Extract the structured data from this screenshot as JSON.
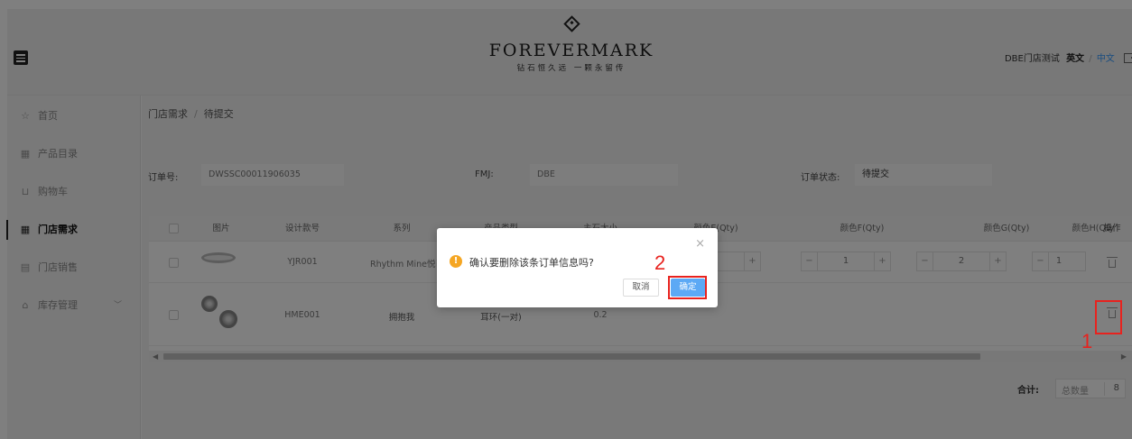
{
  "header": {
    "brand": "FOREVERMARK",
    "tagline": "钻石恒久远 一颗永留传",
    "store": "DBE门店测试",
    "lang_en": "英文",
    "lang_sep": "/",
    "lang_zh": "中文",
    "colors": {
      "accent": "#3399ff"
    }
  },
  "sidebar": {
    "items": [
      {
        "label": "首页",
        "icon": "home-icon"
      },
      {
        "label": "产品目录",
        "icon": "grid-icon"
      },
      {
        "label": "购物车",
        "icon": "cart-icon"
      },
      {
        "label": "门店需求",
        "icon": "grid-icon",
        "active": true
      },
      {
        "label": "门店销售",
        "icon": "receipt-icon"
      },
      {
        "label": "库存管理",
        "icon": "house-icon",
        "expandable": true
      }
    ]
  },
  "breadcrumb": {
    "parent": "门店需求",
    "sep": "/",
    "current": "待提交"
  },
  "form": {
    "order_no_label": "订单号:",
    "order_no": "DWSSC00011906035",
    "fmj_label": "FMJ:",
    "fmj": "DBE",
    "status_label": "订单状态:",
    "status": "待提交"
  },
  "table": {
    "columns": [
      "图片",
      "设计款号",
      "系列",
      "产品类型",
      "主石大小",
      "颜色E(Qty)",
      "颜色F(Qty)",
      "颜色G(Qty)",
      "颜色H(Qty",
      "操作"
    ],
    "rows": [
      {
        "design": "YJR001",
        "series": "Rhythm Mine悦己",
        "type": "",
        "size": "",
        "qty_e": "",
        "qty_f": "1",
        "qty_g": "2",
        "qty_h": "1"
      },
      {
        "design": "HME001",
        "series": "拥抱我",
        "type": "耳环(一对)",
        "size": "0.2",
        "qty_e": "",
        "qty_f": "",
        "qty_g": "",
        "qty_h": ""
      }
    ]
  },
  "total": {
    "label": "合计:",
    "key": "总数量",
    "value": "8"
  },
  "dialog": {
    "message": "确认要删除该条订单信息吗?",
    "cancel": "取消",
    "confirm": "确定",
    "close": "×"
  },
  "annotations": {
    "one": "1",
    "two": "2",
    "color": "#e8221e"
  }
}
